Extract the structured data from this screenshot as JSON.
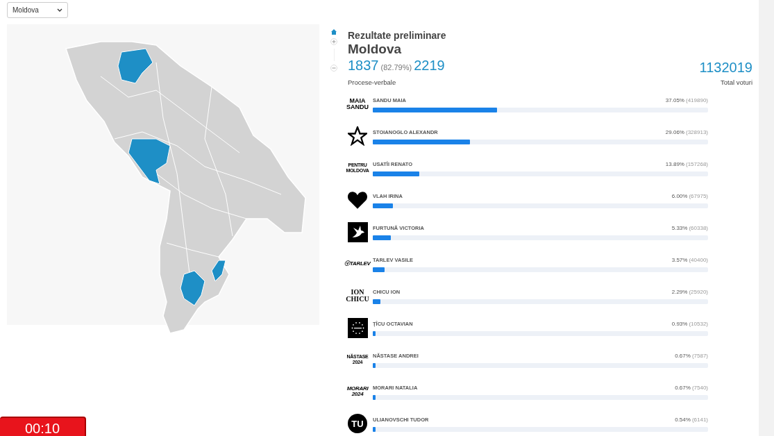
{
  "region_select": {
    "value": "Moldova"
  },
  "header": {
    "title": "Rezultate preliminare",
    "region": "Moldova",
    "reported": "1837",
    "reported_pct": "(82.79%)",
    "total_stations": "2219",
    "reported_label": "Procese-verbale",
    "total_votes": "1132019",
    "total_votes_label": "Total voturi"
  },
  "candidates": [
    {
      "name": "SANDU MAIA",
      "pct": "37.05%",
      "votes": "(419890)",
      "level": 0.3705,
      "logo": {
        "kind": "text",
        "lines": [
          "MAIA",
          "SANDU"
        ]
      }
    },
    {
      "name": "STOIANOGLO ALEXANDR",
      "pct": "29.06%",
      "votes": "(328913)",
      "level": 0.2906,
      "logo": {
        "kind": "star"
      }
    },
    {
      "name": "USATÎI RENATO",
      "pct": "13.89%",
      "votes": "(157268)",
      "level": 0.1389,
      "logo": {
        "kind": "small-text",
        "lines": [
          "PENTRU",
          "MOLDOVA"
        ]
      }
    },
    {
      "name": "VLAH IRINA",
      "pct": "6.00%",
      "votes": "(67975)",
      "level": 0.06,
      "logo": {
        "kind": "heart"
      }
    },
    {
      "name": "FURTUNĂ VICTORIA",
      "pct": "5.33%",
      "votes": "(60338)",
      "level": 0.0533,
      "logo": {
        "kind": "dove"
      }
    },
    {
      "name": "TARLEV VASILE",
      "pct": "3.57%",
      "votes": "(40400)",
      "level": 0.0357,
      "logo": {
        "kind": "italic-text",
        "lines": [
          "ⓥTARLEV"
        ]
      }
    },
    {
      "name": "CHICU ION",
      "pct": "2.29%",
      "votes": "(25920)",
      "level": 0.0229,
      "logo": {
        "kind": "serif-text",
        "lines": [
          "ION",
          "CHICU"
        ]
      }
    },
    {
      "name": "ȚÎCU OCTAVIAN",
      "pct": "0.93%",
      "votes": "(10532)",
      "level": 0.0093,
      "logo": {
        "kind": "stars-square"
      }
    },
    {
      "name": "NĂSTASE ANDREI",
      "pct": "0.67%",
      "votes": "(7587)",
      "level": 0.0067,
      "logo": {
        "kind": "small-text",
        "lines": [
          "NĂSTASE",
          "2024"
        ]
      }
    },
    {
      "name": "MORARI NATALIA",
      "pct": "0.67%",
      "votes": "(7540)",
      "level": 0.0067,
      "logo": {
        "kind": "italic-text",
        "lines": [
          "MORARI",
          "2024"
        ]
      }
    },
    {
      "name": "ULIANOVSCHI TUDOR",
      "pct": "0.54%",
      "votes": "(6141)",
      "level": 0.0054,
      "logo": {
        "kind": "circle-text",
        "lines": [
          "TU"
        ]
      }
    }
  ],
  "timer": "00:10"
}
